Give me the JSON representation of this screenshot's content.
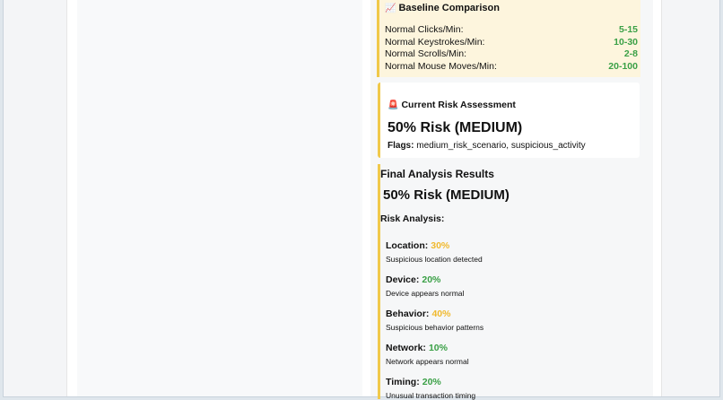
{
  "baseline": {
    "icon": "chart-increasing-icon",
    "title": "Baseline Comparison",
    "rows": [
      {
        "label": "Normal Clicks/Min:",
        "value": "5-15"
      },
      {
        "label": "Normal Keystrokes/Min:",
        "value": "10-30"
      },
      {
        "label": "Normal Scrolls/Min:",
        "value": "2-8"
      },
      {
        "label": "Normal Mouse Moves/Min:",
        "value": "20-100"
      }
    ]
  },
  "current": {
    "icon": "siren-icon",
    "title": "Current Risk Assessment",
    "risk": "50% Risk (MEDIUM)",
    "flags_label": "Flags:",
    "flags_value": "medium_risk_scenario, suspicious_activity"
  },
  "final": {
    "title": "Final Analysis Results",
    "risk": "50% Risk (MEDIUM)",
    "analysis_label": "Risk Analysis:",
    "factors": [
      {
        "name": "Location:",
        "pct": "30%",
        "level": "medium",
        "desc": "Suspicious location detected"
      },
      {
        "name": "Device:",
        "pct": "20%",
        "level": "low",
        "desc": "Device appears normal"
      },
      {
        "name": "Behavior:",
        "pct": "40%",
        "level": "medium",
        "desc": "Suspicious behavior patterns"
      },
      {
        "name": "Network:",
        "pct": "10%",
        "level": "low",
        "desc": "Network appears normal"
      },
      {
        "name": "Timing:",
        "pct": "20%",
        "level": "low",
        "desc": "Unusual transaction timing"
      }
    ]
  },
  "colors": {
    "accent": "#f0c94a",
    "medium": "#f0b92e",
    "low": "#3aa046",
    "baseline_bg": "#fdf5dd"
  }
}
